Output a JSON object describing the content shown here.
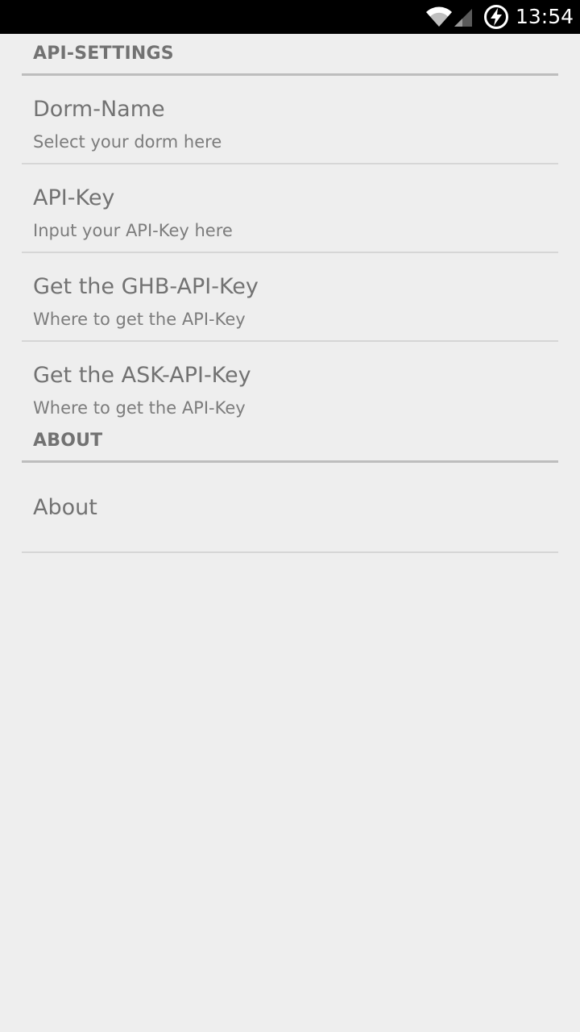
{
  "status_bar": {
    "time": "13:54",
    "icons": [
      "wifi-icon",
      "cell-signal-icon",
      "battery-charging-icon"
    ]
  },
  "sections": [
    {
      "title": "API-SETTINGS",
      "items": [
        {
          "title": "Dorm-Name",
          "summary": "Select your dorm here"
        },
        {
          "title": "API-Key",
          "summary": "Input your API-Key here"
        },
        {
          "title": "Get the GHB-API-Key",
          "summary": "Where to get the API-Key"
        },
        {
          "title": "Get the ASK-API-Key",
          "summary": "Where to get the API-Key"
        }
      ]
    },
    {
      "title": "ABOUT",
      "items": [
        {
          "title": "About"
        }
      ]
    }
  ],
  "colors": {
    "background": "#eeeeee",
    "text_primary": "#727272",
    "text_secondary": "#7c7c7c",
    "section_divider": "#bdbdbd",
    "item_divider": "#d6d6d6",
    "status_bar": "#000000"
  }
}
